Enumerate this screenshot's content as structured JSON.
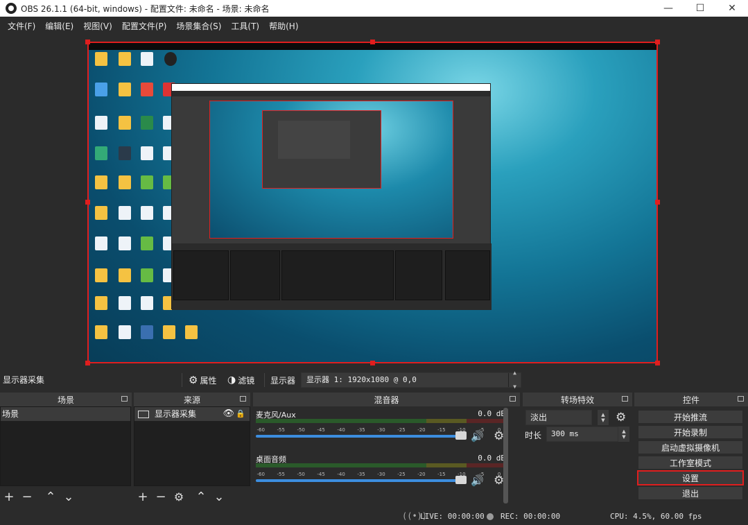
{
  "window": {
    "title": "OBS 26.1.1 (64-bit, windows) - 配置文件: 未命名 - 场景: 未命名",
    "controls": [
      "—",
      "☐",
      "✕"
    ]
  },
  "menu": [
    "文件(F)",
    "编辑(E)",
    "视图(V)",
    "配置文件(P)",
    "场景集合(S)",
    "工具(T)",
    "帮助(H)"
  ],
  "source_toolbar": {
    "source_name": "显示器采集",
    "properties_label": "属性",
    "filters_label": "滤镜",
    "display_label": "显示器",
    "display_value": "显示器 1: 1920x1080 @ 0,0"
  },
  "scenes": {
    "header": "场景",
    "items": [
      "场景"
    ]
  },
  "sources": {
    "header": "来源",
    "items": [
      "显示器采集"
    ]
  },
  "mixer": {
    "header": "混音器",
    "channels": [
      {
        "name": "麦克风/Aux",
        "db": "0.0 dB"
      },
      {
        "name": "桌面音频",
        "db": "0.0 dB"
      }
    ],
    "ticks": [
      "-60",
      "-55",
      "-50",
      "-45",
      "-40",
      "-35",
      "-30",
      "-25",
      "-20",
      "-15",
      "-10",
      "-5",
      "0"
    ]
  },
  "transitions": {
    "header": "转场特效",
    "selected": "淡出",
    "duration_label": "时长",
    "duration_value": "300 ms"
  },
  "controls": {
    "header": "控件",
    "buttons": [
      "开始推流",
      "开始录制",
      "启动虚拟摄像机",
      "工作室模式",
      "设置",
      "退出"
    ]
  },
  "status": {
    "live": "LIVE: 00:00:00",
    "rec": "REC: 00:00:00",
    "cpu": "CPU: 4.5%, 60.00 fps"
  }
}
